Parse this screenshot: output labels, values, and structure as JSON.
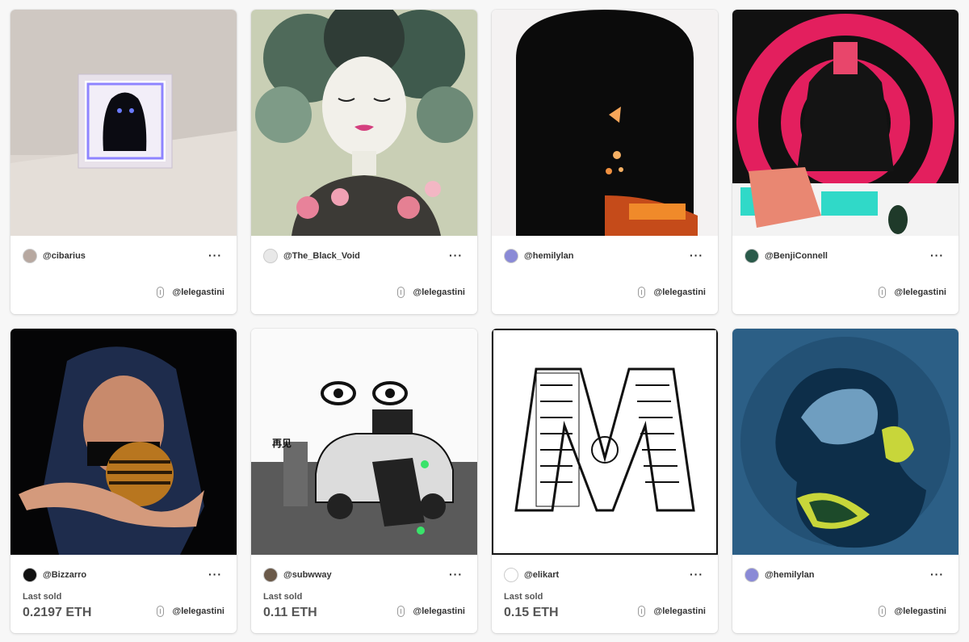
{
  "cards": [
    {
      "creator": "@cibarius",
      "more": "···",
      "owner": "@lelegastini",
      "last_sold_label": "",
      "price": ""
    },
    {
      "creator": "@The_Black_Void",
      "more": "···",
      "owner": "@lelegastini",
      "last_sold_label": "",
      "price": ""
    },
    {
      "creator": "@hemilylan",
      "more": "···",
      "owner": "@lelegastini",
      "last_sold_label": "",
      "price": ""
    },
    {
      "creator": "@BenjiConnell",
      "more": "···",
      "owner": "@lelegastini",
      "last_sold_label": "",
      "price": ""
    },
    {
      "creator": "@Bizzarro",
      "more": "···",
      "owner": "@lelegastini",
      "last_sold_label": "Last sold",
      "price": "0.2197 ETH"
    },
    {
      "creator": "@subwway",
      "more": "···",
      "owner": "@lelegastini",
      "last_sold_label": "Last sold",
      "price": "0.11 ETH"
    },
    {
      "creator": "@elikart",
      "more": "···",
      "owner": "@lelegastini",
      "last_sold_label": "Last sold",
      "price": "0.15 ETH"
    },
    {
      "creator": "@hemilylan",
      "more": "···",
      "owner": "@lelegastini",
      "last_sold_label": "",
      "price": ""
    }
  ],
  "artwork_text": {
    "sign_left": "再见"
  },
  "icons": {
    "owner": "wallet-icon",
    "menu": "more-options-icon"
  }
}
